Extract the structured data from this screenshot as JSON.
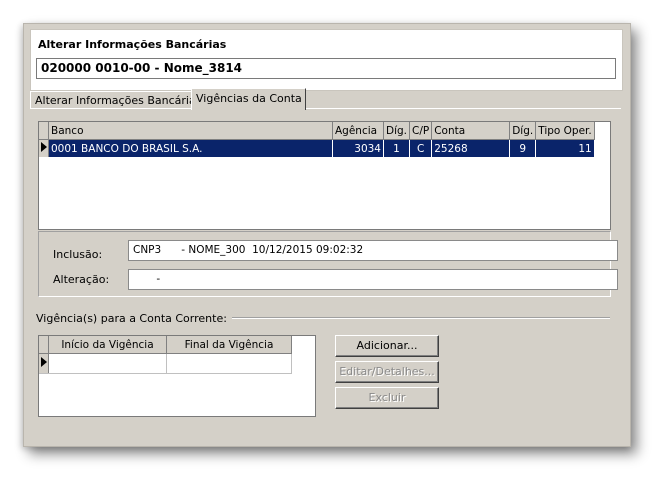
{
  "window": {
    "title": "Alterar Informações Bancárias",
    "account_value": "020000 0010-00 - Nome_3814"
  },
  "tabs": [
    {
      "label": "Alterar Informações Bancárias",
      "active": false
    },
    {
      "label": "Vigências da Conta",
      "active": true
    }
  ],
  "accounts_grid": {
    "columns": [
      "Banco",
      "Agência",
      "Díg.",
      "C/P",
      "Conta",
      "Díg.",
      "Tipo Oper."
    ],
    "rows": [
      {
        "banco": "0001  BANCO DO BRASIL S.A.",
        "agencia": "3034",
        "dig": "1",
        "cp": "C",
        "conta": "25268",
        "dig2": "9",
        "tipo": "11",
        "selected": true
      }
    ]
  },
  "info": {
    "inclusao_label": "Inclusão:",
    "inclusao_value": "CNP3      - NOME_300  10/12/2015 09:02:32",
    "alteracao_label": "Alteração:",
    "alteracao_value": "       -"
  },
  "vigencias": {
    "section_label": "Vigência(s) para a Conta Corrente:",
    "columns": [
      "Início da Vigência",
      "Final da Vigência"
    ]
  },
  "buttons": {
    "add": "Adicionar...",
    "edit": "Editar/Detalhes...",
    "delete": "Excluir"
  },
  "colors": {
    "selection": "#0a246a",
    "window_bg": "#d4d0c8"
  }
}
